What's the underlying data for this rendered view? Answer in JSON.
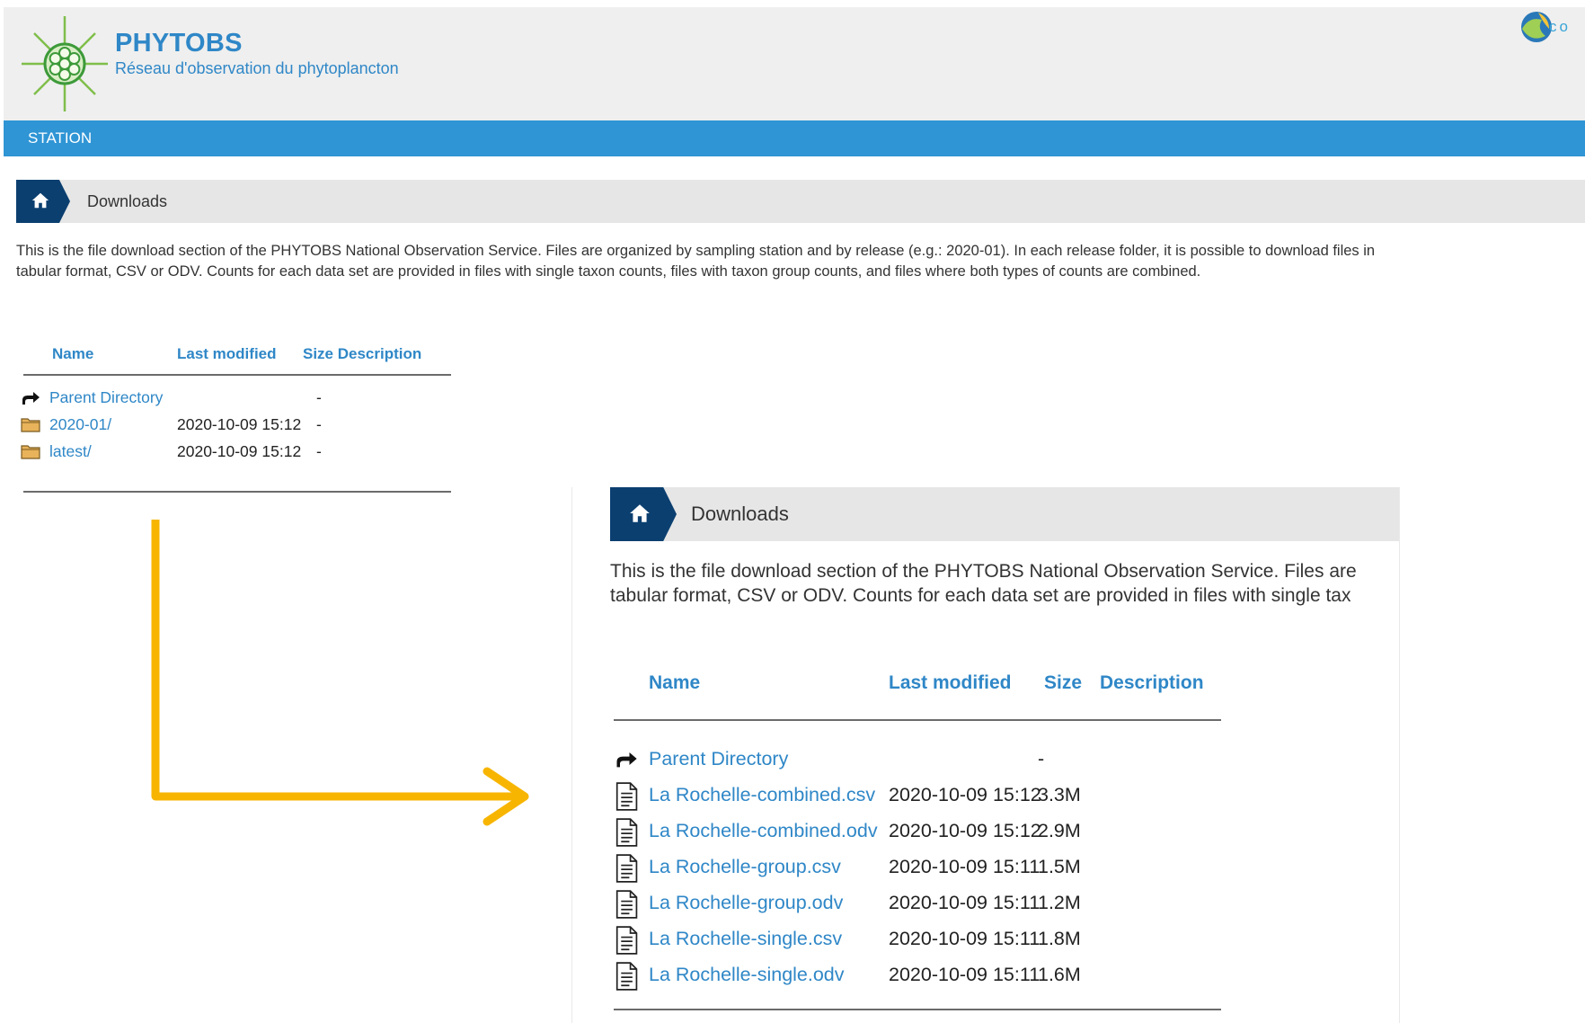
{
  "header": {
    "title": "PHYTOBS",
    "subtitle": "Réseau d'observation du phytoplancton",
    "partner_logo_text": "co"
  },
  "nav": {
    "station_label": "STATION"
  },
  "breadcrumb": {
    "label": "Downloads"
  },
  "intro": {
    "line1": "This is the file download section of the PHYTOBS National Observation Service. Files are organized by sampling station and by release (e.g.: 2020-01). In each release folder, it is possible to download files in",
    "line2": "tabular format, CSV or ODV. Counts for each data set are provided in files with single taxon counts, files with taxon group counts, and files where both types of counts are combined.",
    "inset_line1": "This is the file download section of the PHYTOBS National Observation Service. Files are",
    "inset_line2": "tabular format, CSV or ODV. Counts for each data set are provided in files with single tax"
  },
  "listing_headers": {
    "name": "Name",
    "last_modified": "Last modified",
    "size": "Size",
    "description": "Description",
    "size_description": "Size Description"
  },
  "root_listing": [
    {
      "icon": "parent-directory-icon",
      "name": "Parent Directory",
      "modified": "",
      "size": "-"
    },
    {
      "icon": "folder-icon",
      "name": "2020-01/",
      "modified": "2020-10-09 15:12",
      "size": "-"
    },
    {
      "icon": "folder-icon",
      "name": "latest/",
      "modified": "2020-10-09 15:12",
      "size": "-"
    }
  ],
  "release_listing": [
    {
      "icon": "parent-directory-icon",
      "name": "Parent Directory",
      "modified": "",
      "size": "-"
    },
    {
      "icon": "file-icon",
      "name": "La Rochelle-combined.csv",
      "modified": "2020-10-09 15:12",
      "size": "3.3M"
    },
    {
      "icon": "file-icon",
      "name": "La Rochelle-combined.odv",
      "modified": "2020-10-09 15:12",
      "size": "2.9M"
    },
    {
      "icon": "file-icon",
      "name": "La Rochelle-group.csv",
      "modified": "2020-10-09 15:11",
      "size": "1.5M"
    },
    {
      "icon": "file-icon",
      "name": "La Rochelle-group.odv",
      "modified": "2020-10-09 15:11",
      "size": "1.2M"
    },
    {
      "icon": "file-icon",
      "name": "La Rochelle-single.csv",
      "modified": "2020-10-09 15:11",
      "size": "1.8M"
    },
    {
      "icon": "file-icon",
      "name": "La Rochelle-single.odv",
      "modified": "2020-10-09 15:11",
      "size": "1.6M"
    }
  ],
  "colors": {
    "brand": "#2f87c7",
    "navbar": "#2f95d5",
    "breadcrumb_home": "#0b3f70",
    "arrow": "#f7b500",
    "folder": "#e8b35a"
  }
}
